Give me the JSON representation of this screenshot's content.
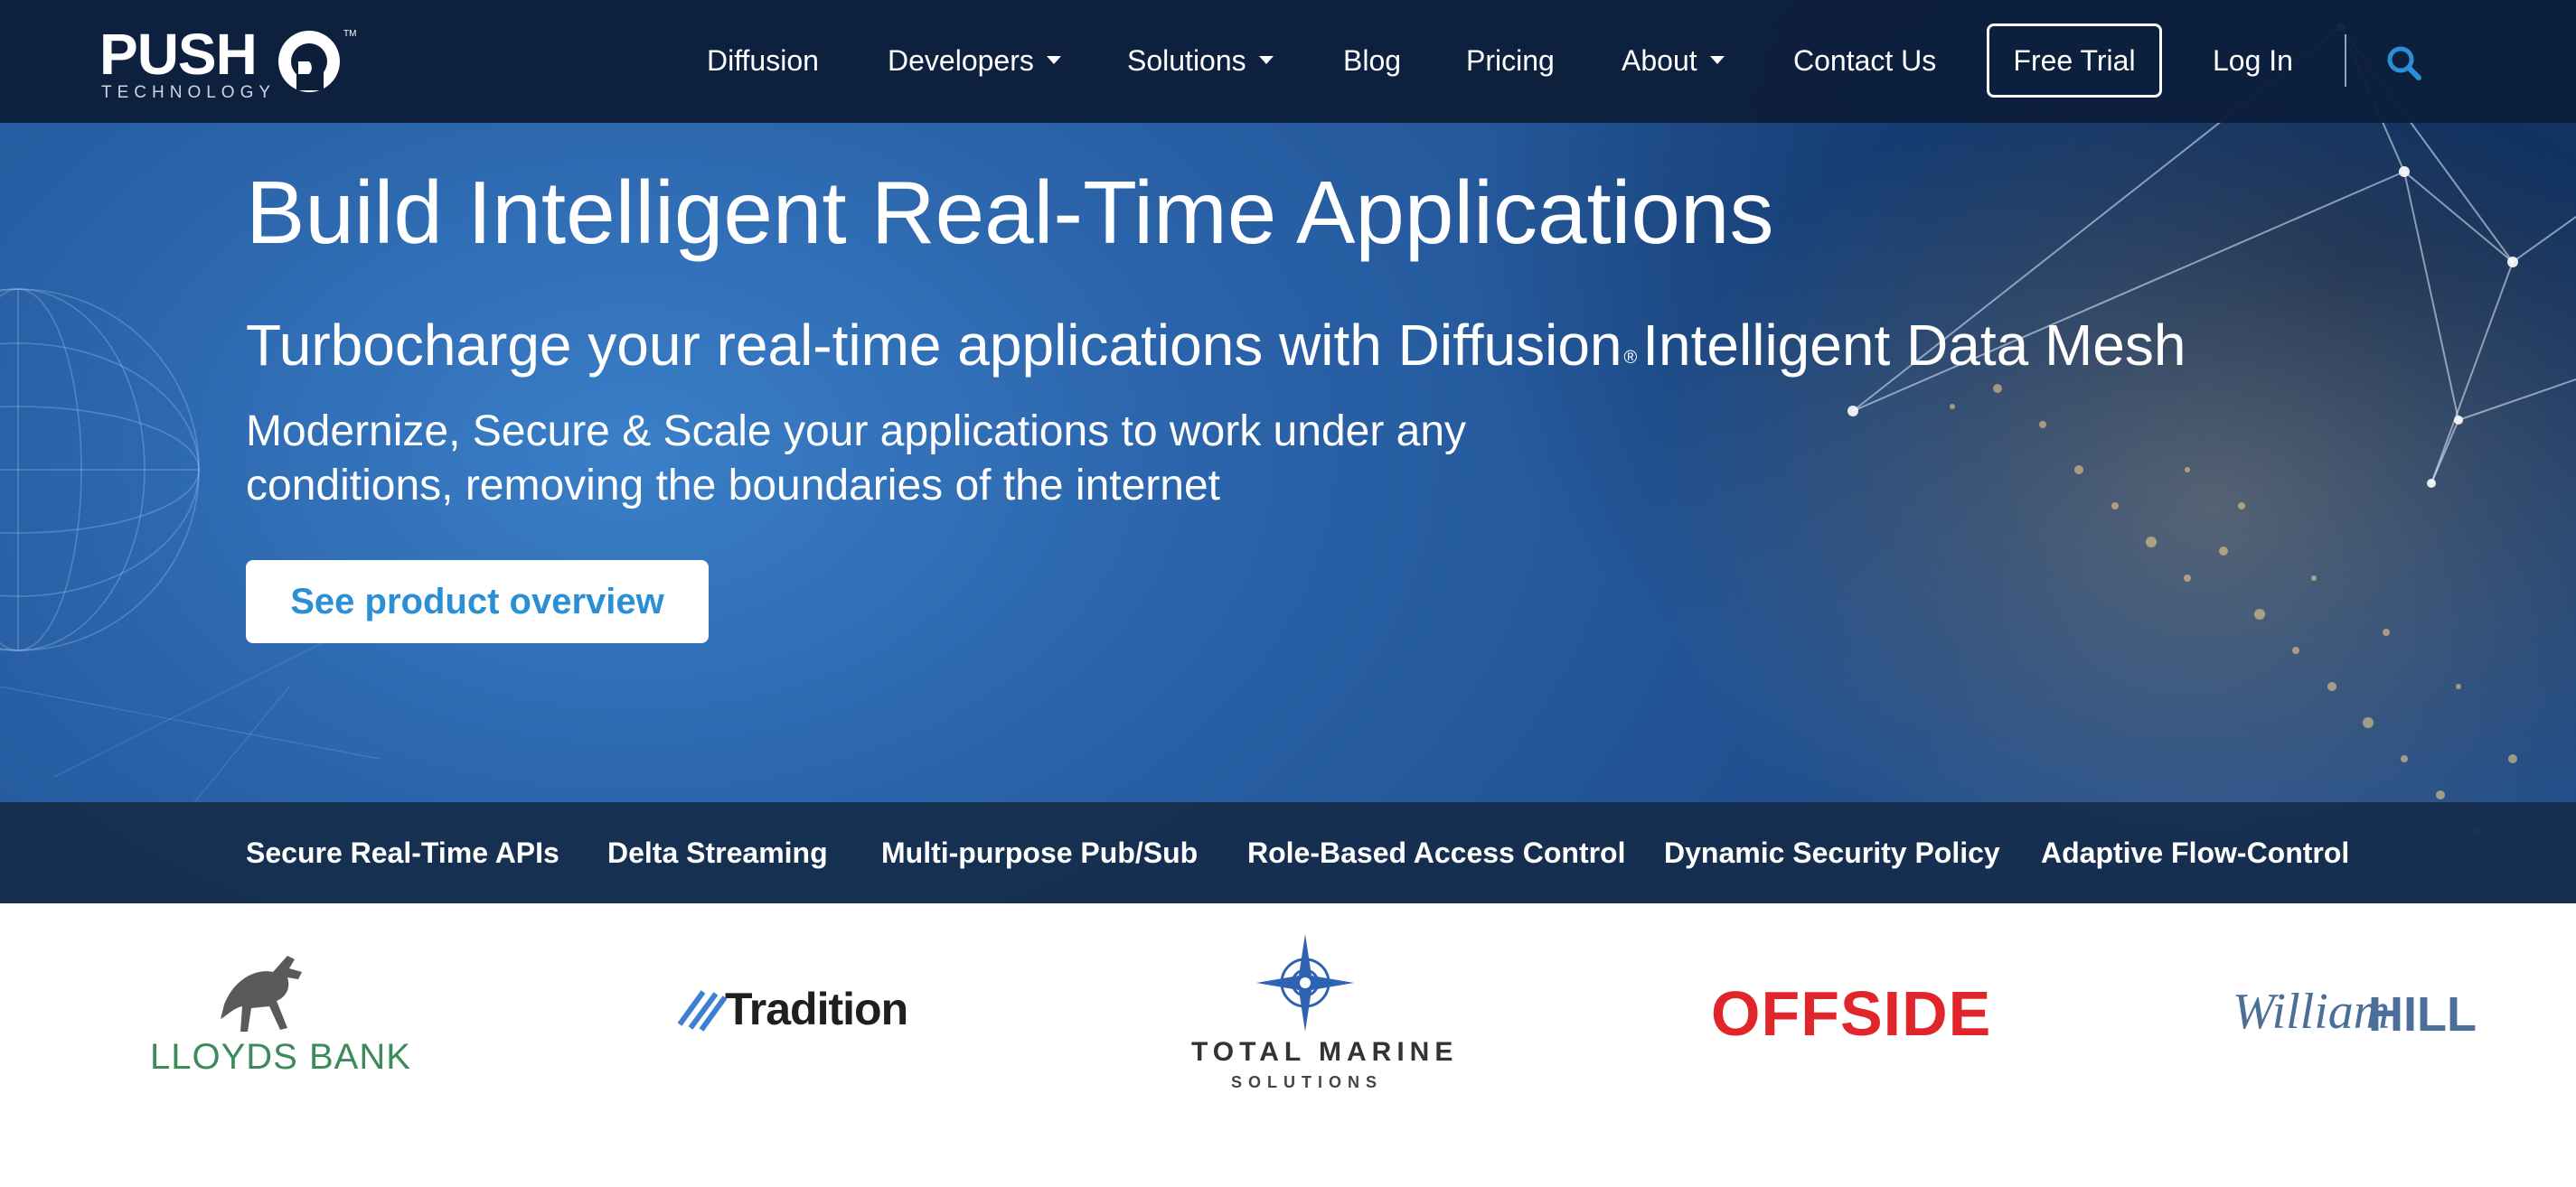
{
  "brand": {
    "logo_text": "PUSH",
    "logo_sub": "TECHNOLOGY",
    "logo_mark_text": "TM"
  },
  "nav": {
    "items": [
      {
        "label": "Diffusion",
        "dropdown": false
      },
      {
        "label": "Developers",
        "dropdown": true
      },
      {
        "label": "Solutions",
        "dropdown": true
      },
      {
        "label": "Blog",
        "dropdown": false
      },
      {
        "label": "Pricing",
        "dropdown": false
      },
      {
        "label": "About",
        "dropdown": true
      },
      {
        "label": "Contact Us",
        "dropdown": false
      }
    ],
    "free_trial": "Free Trial",
    "login": "Log In",
    "search_icon": "search-icon"
  },
  "hero": {
    "headline": "Build Intelligent Real-Time Applications",
    "subhead_pre": "Turbocharge your real-time applications with Diffusion",
    "subhead_reg": "®",
    "subhead_post": "Intelligent Data Mesh",
    "tagline": "Modernize, Secure & Scale your applications to work under any conditions, removing the boundaries of the internet",
    "cta": "See product overview"
  },
  "features": [
    "Secure Real-Time APIs",
    "Delta Streaming",
    "Multi-purpose Pub/Sub",
    "Role-Based Access Control",
    "Dynamic Security Policy",
    "Adaptive Flow-Control"
  ],
  "customers": {
    "lloyds": "LLOYDS BANK",
    "tradition": "Tradition",
    "total_marine": "TOTAL MARINE",
    "total_marine_sub": "SOLUTIONS",
    "offside": "OFFSIDE",
    "william": "William",
    "hill": "HILL"
  },
  "colors": {
    "nav_bg": "#0c1e3a",
    "accent_blue": "#2b8fd6",
    "feature_bar_bg": "#162e4e",
    "offside_red": "#e0252b",
    "lloyds_green": "#3e8a5a"
  }
}
